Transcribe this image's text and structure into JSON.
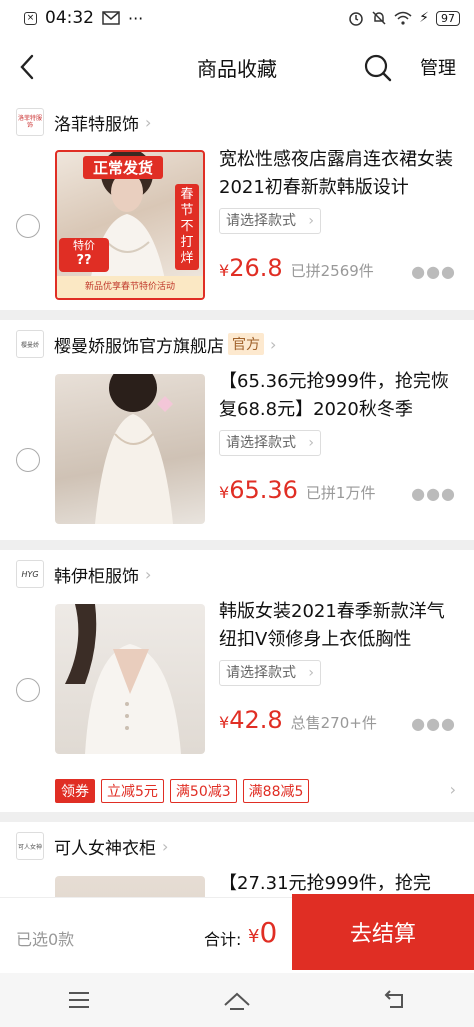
{
  "status_bar": {
    "time": "04:32",
    "battery": "97"
  },
  "nav": {
    "title": "商品收藏",
    "manage": "管理"
  },
  "shops": [
    {
      "name": "洛菲特服饰",
      "logo_text": "洛菲特服饰",
      "item": {
        "title": "宽松性感夜店露肩连衣裙女装2021初春新款韩版设计",
        "spec": "请选择款式",
        "price_symbol": "¥",
        "price": "26.8",
        "sold": "已拼2569件",
        "thumb_banner": "正常发货",
        "thumb_side": "春节不打烊",
        "thumb_badge": "特价",
        "thumb_footer": "新品优享春节特价活动"
      }
    },
    {
      "name": "樱曼娇服饰官方旗舰店",
      "logo_text": "樱曼娇",
      "badge": "官方",
      "item": {
        "title": "【65.36元抢999件，抢完恢复68.8元】2020秋冬季",
        "spec": "请选择款式",
        "price_symbol": "¥",
        "price": "65.36",
        "sold": "已拼1万件"
      }
    },
    {
      "name": "韩伊柜服饰",
      "logo_text": "HYG",
      "item": {
        "title": "韩版女装2021春季新款洋气纽扣V领修身上衣低胸性",
        "spec": "请选择款式",
        "price_symbol": "¥",
        "price": "42.8",
        "sold": "总售270+件"
      },
      "promos": {
        "coupon": "领券",
        "tags": [
          "立减5元",
          "满50减3",
          "满88减5"
        ]
      }
    },
    {
      "name": "可人女神衣柜",
      "logo_text": "可人女神",
      "item": {
        "title": "【27.31元抢999件，抢完"
      }
    }
  ],
  "bottom": {
    "selected": "已选0款",
    "total_label": "合计:",
    "total_symbol": "¥",
    "total_value": "0",
    "checkout": "去结算"
  },
  "colors": {
    "accent": "#e02e24"
  }
}
